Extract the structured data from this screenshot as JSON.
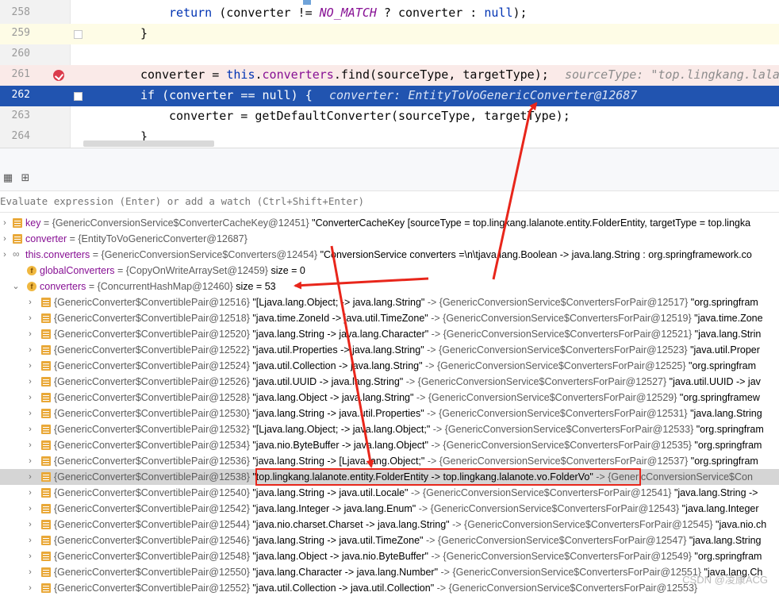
{
  "editor": {
    "lines": [
      {
        "num": "258",
        "tokens": [
          {
            "t": "return",
            "c": "kw"
          },
          {
            "t": " (converter != ",
            "c": ""
          },
          {
            "t": "NO_MATCH",
            "c": "const"
          },
          {
            "t": " ? converter : ",
            "c": ""
          },
          {
            "t": "null",
            "c": "kw"
          },
          {
            "t": ");",
            "c": ""
          }
        ],
        "hint": ""
      },
      {
        "num": "259",
        "tokens": [
          {
            "t": "}",
            "c": ""
          }
        ],
        "hint": ""
      },
      {
        "num": "260",
        "tokens": [],
        "hint": ""
      },
      {
        "num": "261",
        "tokens": [
          {
            "t": "converter = ",
            "c": ""
          },
          {
            "t": "this",
            "c": "kw"
          },
          {
            "t": ".",
            "c": ""
          },
          {
            "t": "converters",
            "c": "field"
          },
          {
            "t": ".find(sourceType, targetType);",
            "c": ""
          }
        ],
        "hint": "sourceType: \"top.lingkang.lala"
      },
      {
        "num": "262",
        "tokens": [
          {
            "t": "if",
            "c": "kw"
          },
          {
            "t": " (converter == ",
            "c": ""
          },
          {
            "t": "null",
            "c": "kw"
          },
          {
            "t": ") {",
            "c": ""
          }
        ],
        "hint": "converter: EntityToVoGenericConverter@12687"
      },
      {
        "num": "263",
        "tokens": [
          {
            "t": "converter = getDefaultConverter(sourceType, targetType);",
            "c": ""
          }
        ],
        "hint": ""
      },
      {
        "num": "264",
        "tokens": [
          {
            "t": "}",
            "c": ""
          }
        ],
        "hint": ""
      }
    ]
  },
  "debugger": {
    "eval_placeholder": "Evaluate expression (Enter) or add a watch (Ctrl+Shift+Enter)",
    "toolbar_icons": [
      "table-icon",
      "layout-icon"
    ],
    "variables": [
      {
        "kind": "list",
        "expand": "right",
        "name": "key",
        "type": "{GenericConversionService$ConverterCacheKey@12451}",
        "value": " \"ConverterCacheKey [sourceType = top.lingkang.lalanote.entity.FolderEntity, targetType = top.lingka"
      },
      {
        "kind": "list",
        "expand": "right",
        "name": "converter",
        "type": "{EntityToVoGenericConverter@12687}",
        "value": ""
      },
      {
        "kind": "oo",
        "expand": "right",
        "name": "this.converters",
        "type": "{GenericConversionService$Converters@12454}",
        "value": " \"ConversionService converters =\\n\\tjava.lang.Boolean -> java.lang.String : org.springframework.co"
      },
      {
        "kind": "field",
        "expand": "",
        "name": "globalConverters",
        "type": "{CopyOnWriteArraySet@12459}",
        "value": "  size = 0"
      },
      {
        "kind": "field",
        "expand": "down",
        "name": "converters",
        "type": "{ConcurrentHashMap@12460}",
        "value": "  size = 53"
      }
    ],
    "pairs": [
      {
        "id": "12516",
        "pair": "\"[Ljava.lang.Object; -> java.lang.String\"",
        "target": "{GenericConversionService$ConvertersForPair@12517}",
        "tail": " \"org.springfram"
      },
      {
        "id": "12518",
        "pair": "\"java.time.ZoneId -> java.util.TimeZone\"",
        "target": "{GenericConversionService$ConvertersForPair@12519}",
        "tail": " \"java.time.Zone"
      },
      {
        "id": "12520",
        "pair": "\"java.lang.String -> java.lang.Character\"",
        "target": "{GenericConversionService$ConvertersForPair@12521}",
        "tail": " \"java.lang.Strin"
      },
      {
        "id": "12522",
        "pair": "\"java.util.Properties -> java.lang.String\"",
        "target": "{GenericConversionService$ConvertersForPair@12523}",
        "tail": " \"java.util.Proper"
      },
      {
        "id": "12524",
        "pair": "\"java.util.Collection -> java.lang.String\"",
        "target": "{GenericConversionService$ConvertersForPair@12525}",
        "tail": " \"org.springfram"
      },
      {
        "id": "12526",
        "pair": "\"java.util.UUID -> java.lang.String\"",
        "target": "{GenericConversionService$ConvertersForPair@12527}",
        "tail": " \"java.util.UUID -> jav"
      },
      {
        "id": "12528",
        "pair": "\"java.lang.Object -> java.lang.String\"",
        "target": "{GenericConversionService$ConvertersForPair@12529}",
        "tail": " \"org.springframew"
      },
      {
        "id": "12530",
        "pair": "\"java.lang.String -> java.util.Properties\"",
        "target": "{GenericConversionService$ConvertersForPair@12531}",
        "tail": " \"java.lang.String"
      },
      {
        "id": "12532",
        "pair": "\"[Ljava.lang.Object; -> java.lang.Object;\"",
        "target": "{GenericConversionService$ConvertersForPair@12533}",
        "tail": " \"org.springfram"
      },
      {
        "id": "12534",
        "pair": "\"java.nio.ByteBuffer -> java.lang.Object\"",
        "target": "{GenericConversionService$ConvertersForPair@12535}",
        "tail": " \"org.springfram"
      },
      {
        "id": "12536",
        "pair": "\"java.lang.String -> [Ljava.lang.Object;\"",
        "target": "{GenericConversionService$ConvertersForPair@12537}",
        "tail": " \"org.springfram"
      },
      {
        "id": "12538",
        "pair": "\"top.lingkang.lalanote.entity.FolderEntity -> top.lingkang.lalanote.vo.FolderVo\"",
        "target": "{GenericConversionService$Con",
        "tail": "",
        "selected": true
      },
      {
        "id": "12540",
        "pair": "\"java.lang.String -> java.util.Locale\"",
        "target": "{GenericConversionService$ConvertersForPair@12541}",
        "tail": " \"java.lang.String -> "
      },
      {
        "id": "12542",
        "pair": "\"java.lang.Integer -> java.lang.Enum\"",
        "target": "{GenericConversionService$ConvertersForPair@12543}",
        "tail": " \"java.lang.Integer"
      },
      {
        "id": "12544",
        "pair": "\"java.nio.charset.Charset -> java.lang.String\"",
        "target": "{GenericConversionService$ConvertersForPair@12545}",
        "tail": " \"java.nio.ch"
      },
      {
        "id": "12546",
        "pair": "\"java.lang.String -> java.util.TimeZone\"",
        "target": "{GenericConversionService$ConvertersForPair@12547}",
        "tail": " \"java.lang.String"
      },
      {
        "id": "12548",
        "pair": "\"java.lang.Object -> java.nio.ByteBuffer\"",
        "target": "{GenericConversionService$ConvertersForPair@12549}",
        "tail": " \"org.springfram"
      },
      {
        "id": "12550",
        "pair": "\"java.lang.Character -> java.lang.Number\"",
        "target": "{GenericConversionService$ConvertersForPair@12551}",
        "tail": " \"java.lang.Ch"
      },
      {
        "id": "12552",
        "pair": "\"java.util.Collection -> java.util.Collection\"",
        "target": "{GenericConversionService$ConvertersForPair@12553}",
        "tail": ""
      }
    ],
    "pair_type_prefix": "{GenericConverter$ConvertiblePair@",
    "arrow_op": " -> "
  },
  "watermark": "CSDN @凌康ACG",
  "colors": {
    "selection": "#2154b0",
    "annotation": "#e8261b",
    "breakpoint": "#db3b4b"
  }
}
